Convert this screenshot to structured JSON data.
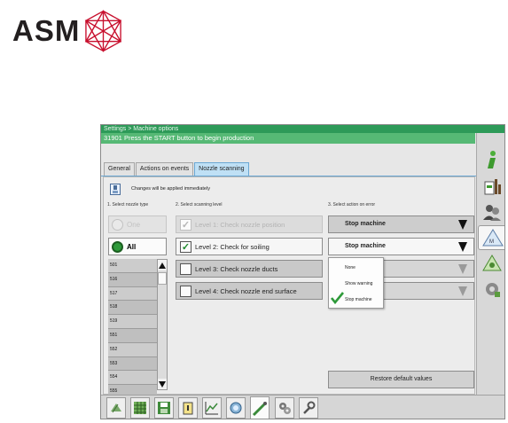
{
  "logo": {
    "text": "ASM"
  },
  "window": {
    "title": "Settings > Machine options",
    "status": "31901 Press the START button to begin production"
  },
  "tabs": [
    {
      "label": "General",
      "active": false
    },
    {
      "label": "Actions on events",
      "active": false
    },
    {
      "label": "Nozzle scanning",
      "active": true
    }
  ],
  "notice": "Changes will be applied immediately",
  "sections": {
    "nozzle_type": "1. Select nozzle type",
    "scanning_level": "2. Select scanning level",
    "action_on_error": "3. Select action on error"
  },
  "nozzle_type": {
    "options": [
      {
        "label": "One",
        "enabled": false,
        "selected": false
      },
      {
        "label": "All",
        "enabled": true,
        "selected": true
      }
    ],
    "list": [
      "501",
      "516",
      "517",
      "518",
      "519",
      "551",
      "552",
      "553",
      "554",
      "555"
    ]
  },
  "levels": [
    {
      "label": "Level 1: Check nozzle position",
      "checked": true,
      "enabled": false
    },
    {
      "label": "Level 2: Check for soiling",
      "checked": true,
      "enabled": true
    },
    {
      "label": "Level 3: Check nozzle ducts",
      "checked": false,
      "enabled": true
    },
    {
      "label": "Level 4: Check nozzle end surface",
      "checked": false,
      "enabled": true
    }
  ],
  "actions": [
    {
      "value": "Stop machine"
    },
    {
      "value": "Stop machine"
    }
  ],
  "action_menu": {
    "options": [
      "None",
      "Show warning",
      "Stop machine"
    ],
    "selected": "Stop machine"
  },
  "restore_label": "Restore default values",
  "sidenav_icons": [
    "info-icon",
    "production-icon",
    "users-icon",
    "machine-setup-icon",
    "warning-icon",
    "gear-icon"
  ],
  "toolbar_icons": [
    "feeders-icon",
    "grid-icon",
    "save-icon",
    "clipboard-icon",
    "chart-icon",
    "camera-icon",
    "nozzle-icon",
    "settings-gears-icon",
    "wrench-icon"
  ],
  "colors": {
    "title_green": "#2d9a58",
    "status_green": "#56b975",
    "tab_active": "#bfe0f5",
    "check_green": "#1f8a2d"
  }
}
